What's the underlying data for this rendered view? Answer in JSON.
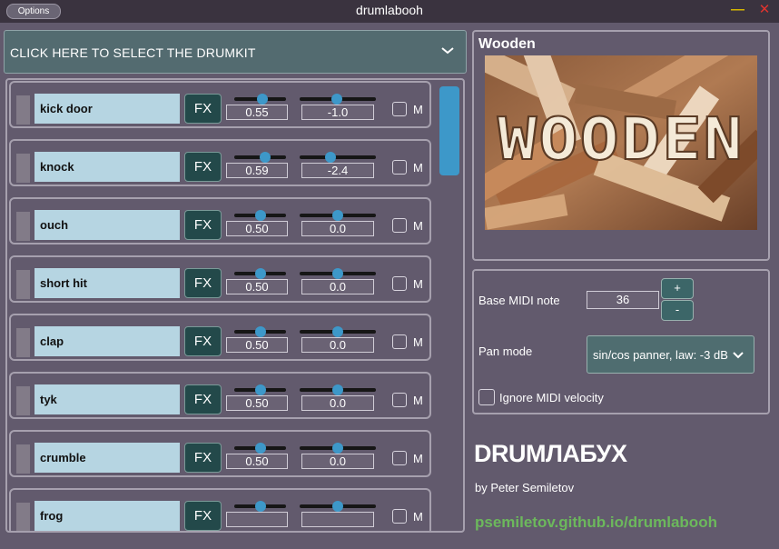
{
  "titlebar": {
    "options_label": "Options",
    "title": "drumlabooh",
    "minimize_glyph": "—",
    "close_glyph": "✕"
  },
  "kit_selector": {
    "label": "CLICK HERE TO SELECT THE DRUMKIT",
    "icon": "chevron-down-icon"
  },
  "instruments": [
    {
      "name": "kick door",
      "fx": "FX",
      "gain": "0.55",
      "gain_level": 0.55,
      "pan": "-1.0",
      "pan_level": 0.49,
      "mute": "M"
    },
    {
      "name": "knock",
      "fx": "FX",
      "gain": "0.59",
      "gain_level": 0.59,
      "pan": "-2.4",
      "pan_level": 0.41,
      "mute": "M"
    },
    {
      "name": "ouch",
      "fx": "FX",
      "gain": "0.50",
      "gain_level": 0.5,
      "pan": "0.0",
      "pan_level": 0.5,
      "mute": "M"
    },
    {
      "name": "short hit",
      "fx": "FX",
      "gain": "0.50",
      "gain_level": 0.5,
      "pan": "0.0",
      "pan_level": 0.5,
      "mute": "M"
    },
    {
      "name": "clap",
      "fx": "FX",
      "gain": "0.50",
      "gain_level": 0.5,
      "pan": "0.0",
      "pan_level": 0.5,
      "mute": "M"
    },
    {
      "name": "tyk",
      "fx": "FX",
      "gain": "0.50",
      "gain_level": 0.5,
      "pan": "0.0",
      "pan_level": 0.5,
      "mute": "M"
    },
    {
      "name": "crumble",
      "fx": "FX",
      "gain": "0.50",
      "gain_level": 0.5,
      "pan": "0.0",
      "pan_level": 0.5,
      "mute": "M"
    },
    {
      "name": "frog",
      "fx": "FX",
      "gain": "",
      "gain_level": 0.5,
      "pan": "",
      "pan_level": 0.5,
      "mute": "M"
    }
  ],
  "kit": {
    "name": "Wooden",
    "image_text": "WOODEN"
  },
  "settings": {
    "base_midi_label": "Base MIDI note",
    "base_midi_value": "36",
    "plus_label": "+",
    "minus_label": "-",
    "pan_mode_label": "Pan mode",
    "pan_mode_value": "sin/cos panner, law: -3 dB",
    "ignore_velocity_label": "Ignore MIDI velocity"
  },
  "branding": {
    "app_name": "DRUMЛАБУХ",
    "author": "by Peter Semiletov",
    "link": "psemiletov.github.io/drumlabooh"
  },
  "colors": {
    "background": "#625a6d",
    "accent": "#3d98c9",
    "link": "#6cb85c",
    "fx_button": "#23494a",
    "name_field": "#b6d5e2"
  }
}
